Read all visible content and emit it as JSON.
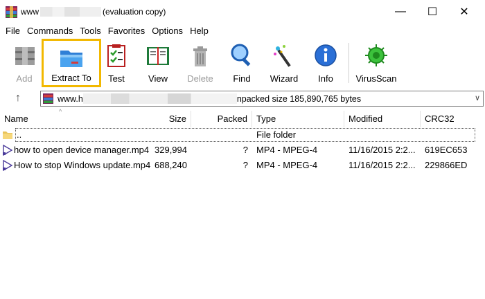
{
  "window": {
    "title_prefix": "www",
    "title_suffix": "(evaluation copy)",
    "minimize": "—",
    "maximize": "☐",
    "close": "✕"
  },
  "menu": [
    "File",
    "Commands",
    "Tools",
    "Favorites",
    "Options",
    "Help"
  ],
  "toolbar": {
    "add": "Add",
    "extract_to": "Extract To",
    "test": "Test",
    "view": "View",
    "delete": "Delete",
    "find": "Find",
    "wizard": "Wizard",
    "info": "Info",
    "virusscan": "VirusScan"
  },
  "address": {
    "prefix": "www.h",
    "suffix": "npacked size 185,890,765 bytes",
    "up_icon": "↑",
    "dropdown_icon": "∨"
  },
  "columns": {
    "name": "Name",
    "size": "Size",
    "packed": "Packed",
    "type": "Type",
    "modified": "Modified",
    "crc": "CRC32"
  },
  "rows": [
    {
      "name": "..",
      "size": "",
      "packed": "",
      "type": "File folder",
      "modified": "",
      "crc": ""
    },
    {
      "name": "how to open device manager.mp4",
      "size": "329,994",
      "packed": "?",
      "type": "MP4 - MPEG-4",
      "modified": "11/16/2015 2:2...",
      "crc": "619EC653"
    },
    {
      "name": "How to stop Windows update.mp4",
      "size": "688,240",
      "packed": "?",
      "type": "MP4 - MPEG-4",
      "modified": "11/16/2015 2:2...",
      "crc": "229866ED"
    }
  ],
  "colors": {
    "highlight": "#f2b800"
  }
}
